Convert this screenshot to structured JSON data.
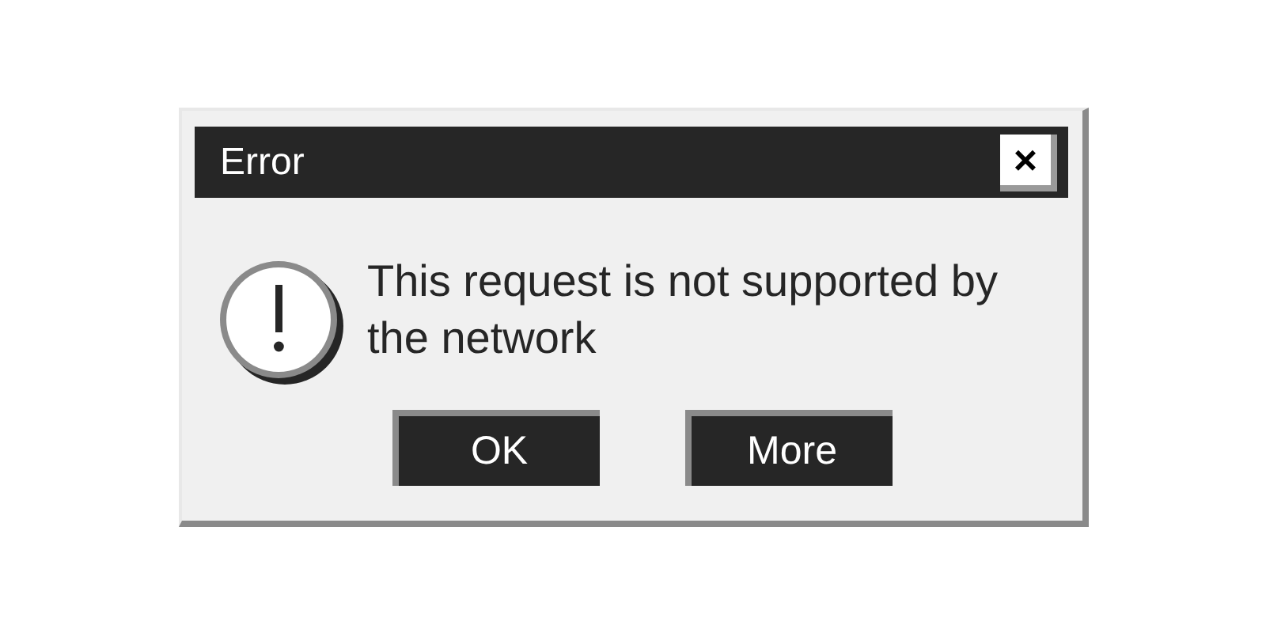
{
  "window": {
    "title": "Error",
    "close_label": "×"
  },
  "message": "This request is not supported by the network",
  "buttons": [
    {
      "label": "OK"
    },
    {
      "label": "More"
    }
  ]
}
